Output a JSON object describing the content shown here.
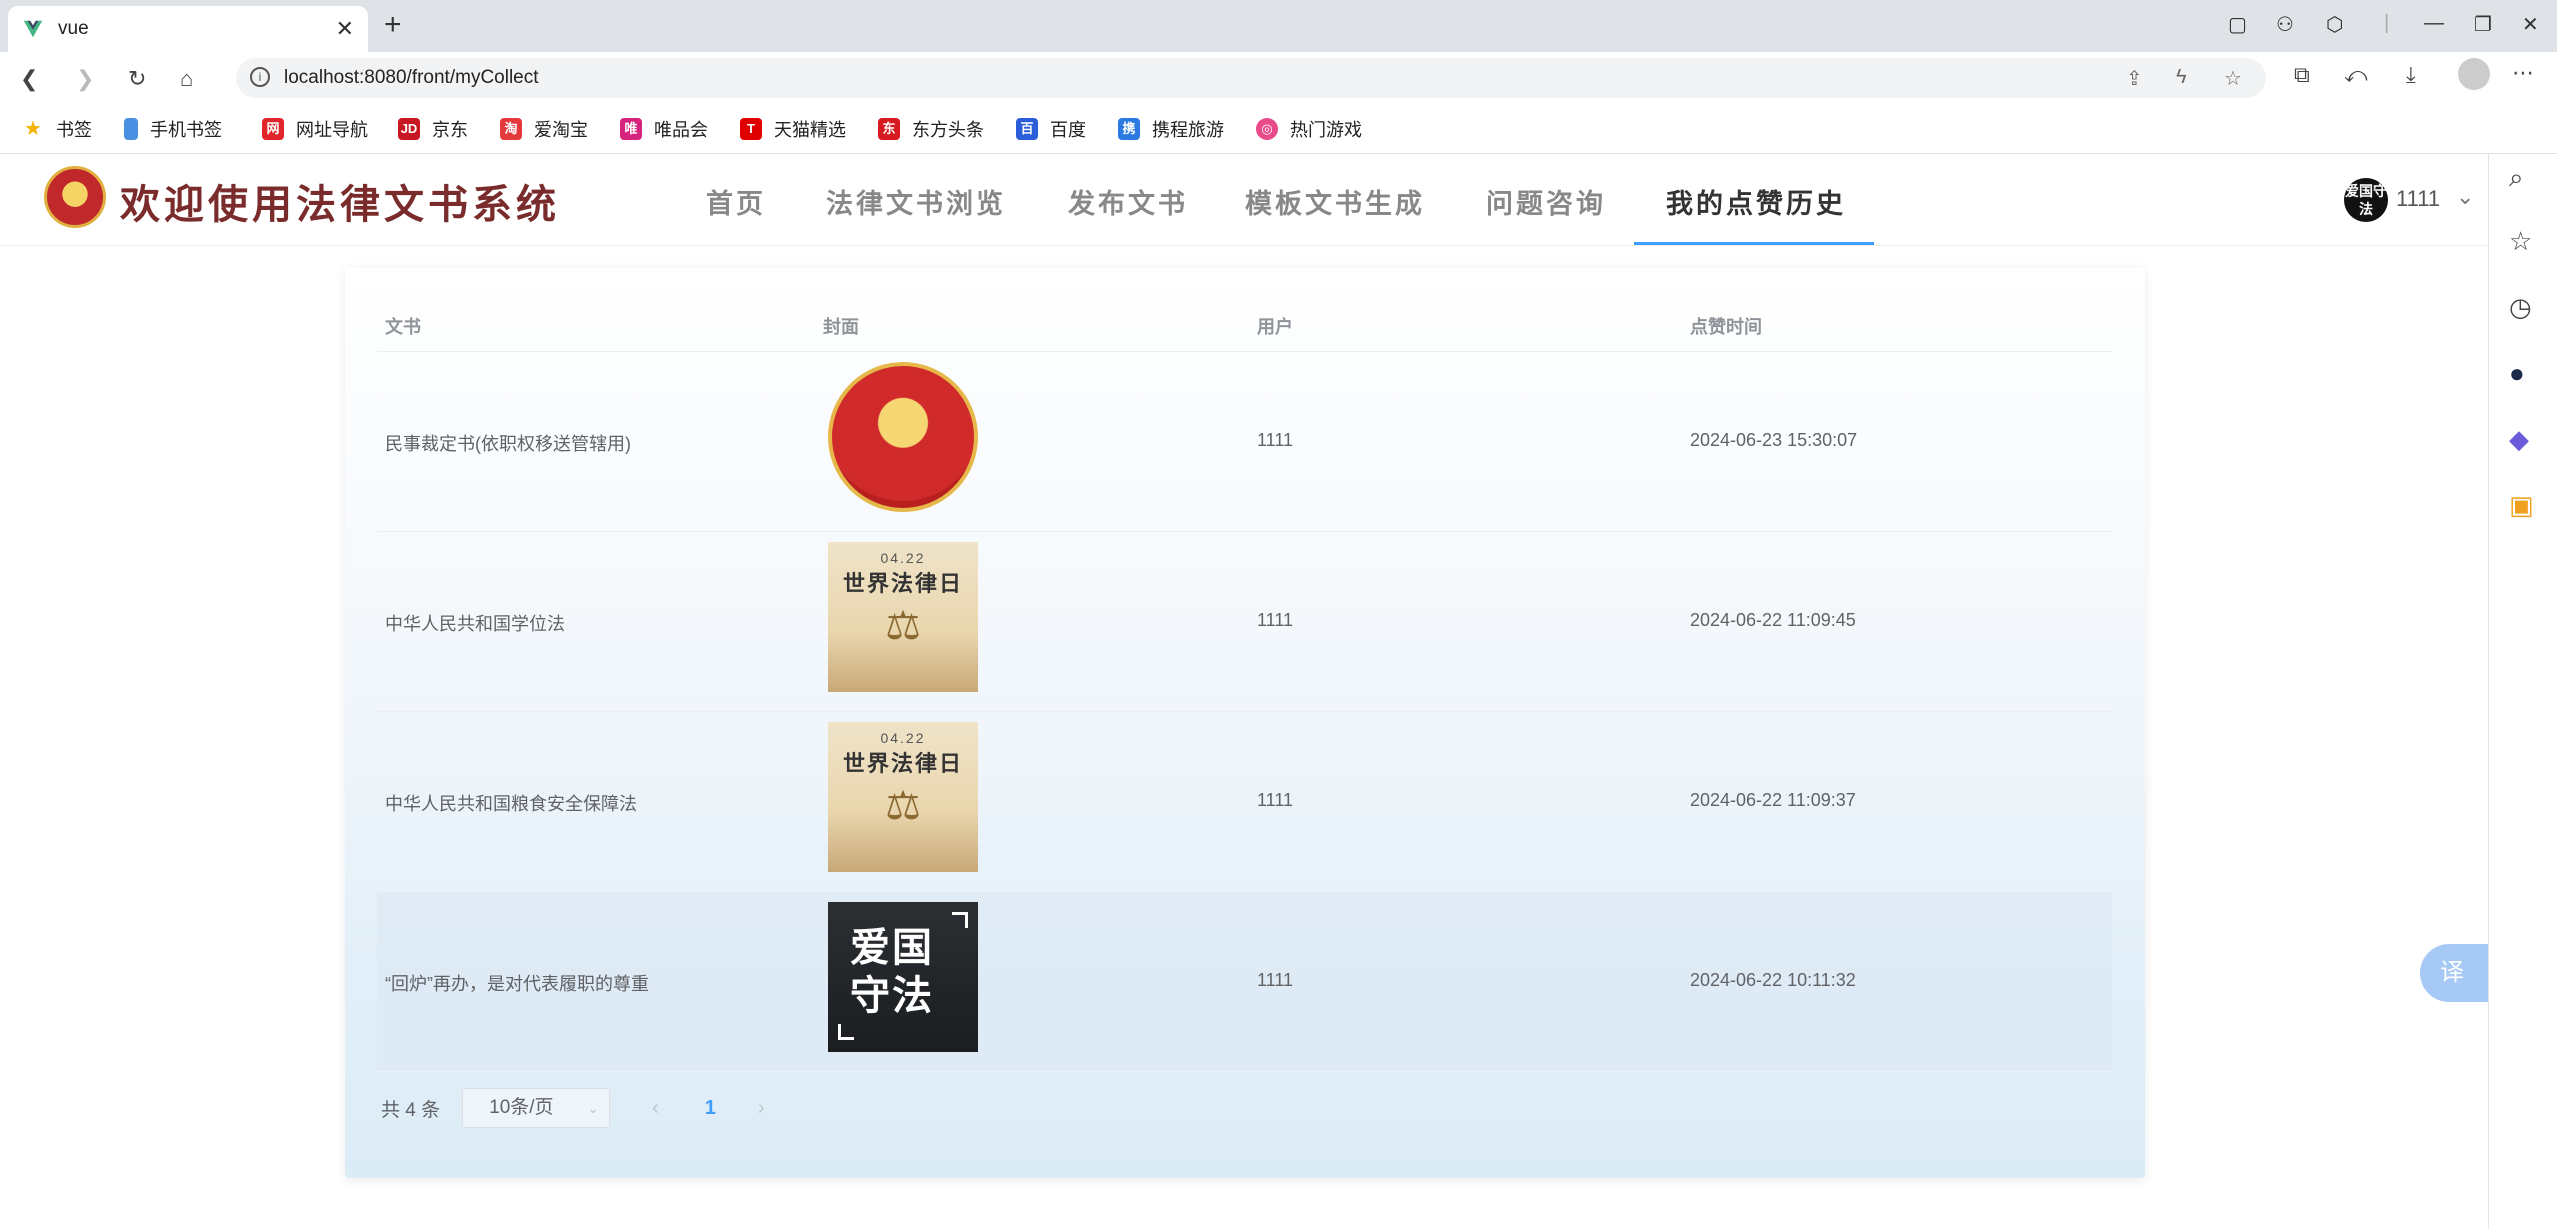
{
  "browser": {
    "tab_title": "vue",
    "url": "localhost:8080/front/myCollect",
    "bookmarks": [
      "书签",
      "手机书签",
      "网址导航",
      "京东",
      "爱淘宝",
      "唯品会",
      "天猫精选",
      "东方头条",
      "百度",
      "携程旅游",
      "热门游戏"
    ],
    "bookmark_colors": [
      "#f5b400",
      "#4a90e2",
      "#e0262b",
      "#c81623",
      "#e4393c",
      "#d6237d",
      "#e10000",
      "#d71920",
      "#2b5fd9",
      "#2a7ae2",
      "#e84a8a"
    ]
  },
  "app": {
    "title": "欢迎使用法律文书系统",
    "menu": [
      "首页",
      "法律文书浏览",
      "发布文书",
      "模板文书生成",
      "问题咨询",
      "我的点赞历史"
    ],
    "active_menu": "我的点赞历史",
    "avatar_text": "爱国守法",
    "username": "1111"
  },
  "table": {
    "headers": [
      "文书",
      "封面",
      "用户",
      "点赞时间"
    ],
    "rows": [
      {
        "doc": "民事裁定书(依职权移送管辖用)",
        "cover": "emblem",
        "user": "1111",
        "time": "2024-06-23 15:30:07"
      },
      {
        "doc": "中华人民共和国学位法",
        "cover": "poster",
        "user": "1111",
        "time": "2024-06-22 11:09:45"
      },
      {
        "doc": "中华人民共和国粮食安全保障法",
        "cover": "poster",
        "user": "1111",
        "time": "2024-06-22 11:09:37"
      },
      {
        "doc": "“回炉”再办，是对代表履职的尊重",
        "cover": "dark",
        "user": "1111",
        "time": "2024-06-22 10:11:32"
      }
    ]
  },
  "poster": {
    "date": "04.22",
    "title": "世界法律日"
  },
  "dark_cover": {
    "text_top": "爱国",
    "text_bottom": "守法"
  },
  "pagination": {
    "total": "共 4 条",
    "page_size": "10条/页",
    "current_page": "1"
  },
  "translate_label": "译"
}
